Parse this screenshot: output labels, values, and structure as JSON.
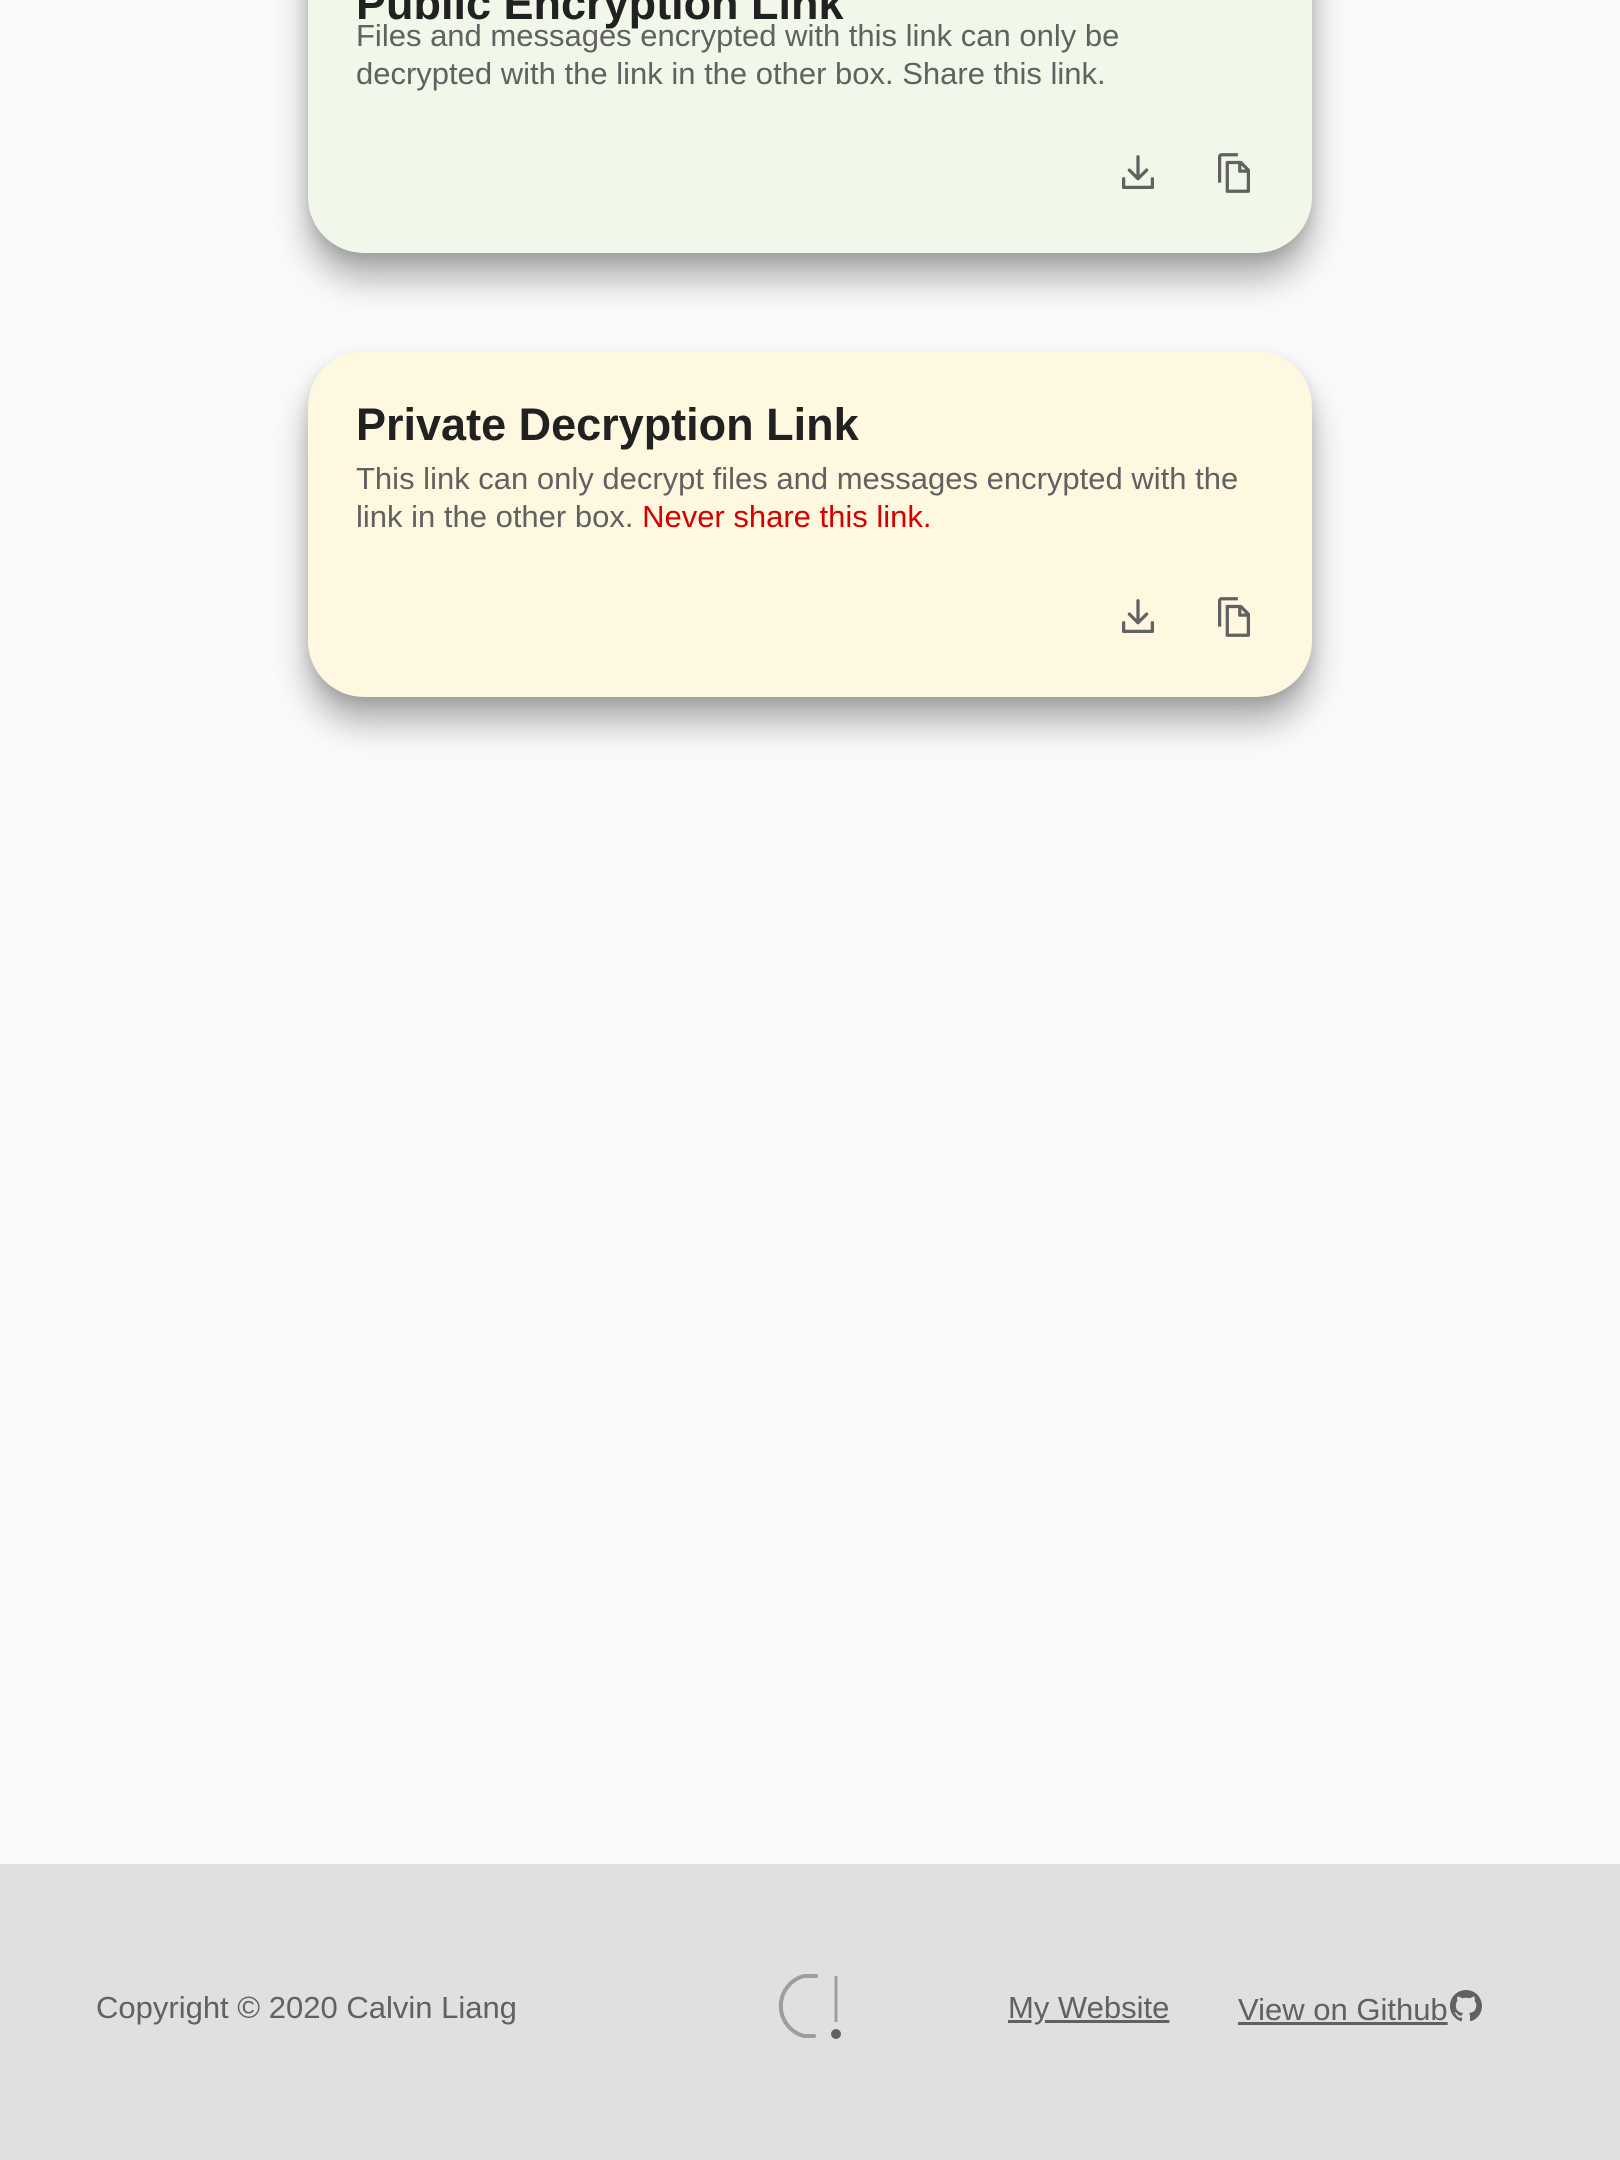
{
  "cards": {
    "public": {
      "title": "Public Encryption Link",
      "description": "Files and messages encrypted with this link can only be decrypted with the link in the other box. Share this link.",
      "download_icon": "download-icon",
      "copy_icon": "copy-icon"
    },
    "private": {
      "title": "Private Decryption Link",
      "description": "This link can only decrypt files and messages encrypted with the link in the other box. ",
      "warning": "Never share this link.",
      "download_icon": "download-icon",
      "copy_icon": "copy-icon"
    }
  },
  "footer": {
    "copyright": "Copyright © 2020 Calvin Liang",
    "logo_icon": "app-logo-icon",
    "links": {
      "website": "My Website",
      "github": "View on Github "
    },
    "github_icon": "github-icon"
  },
  "colors": {
    "background": "#fafafa",
    "public_card": "#f1f8e9",
    "private_card": "#fff8e1",
    "footer": "#e0e0e0",
    "warning": "#d50000",
    "text_secondary": "#616161"
  }
}
